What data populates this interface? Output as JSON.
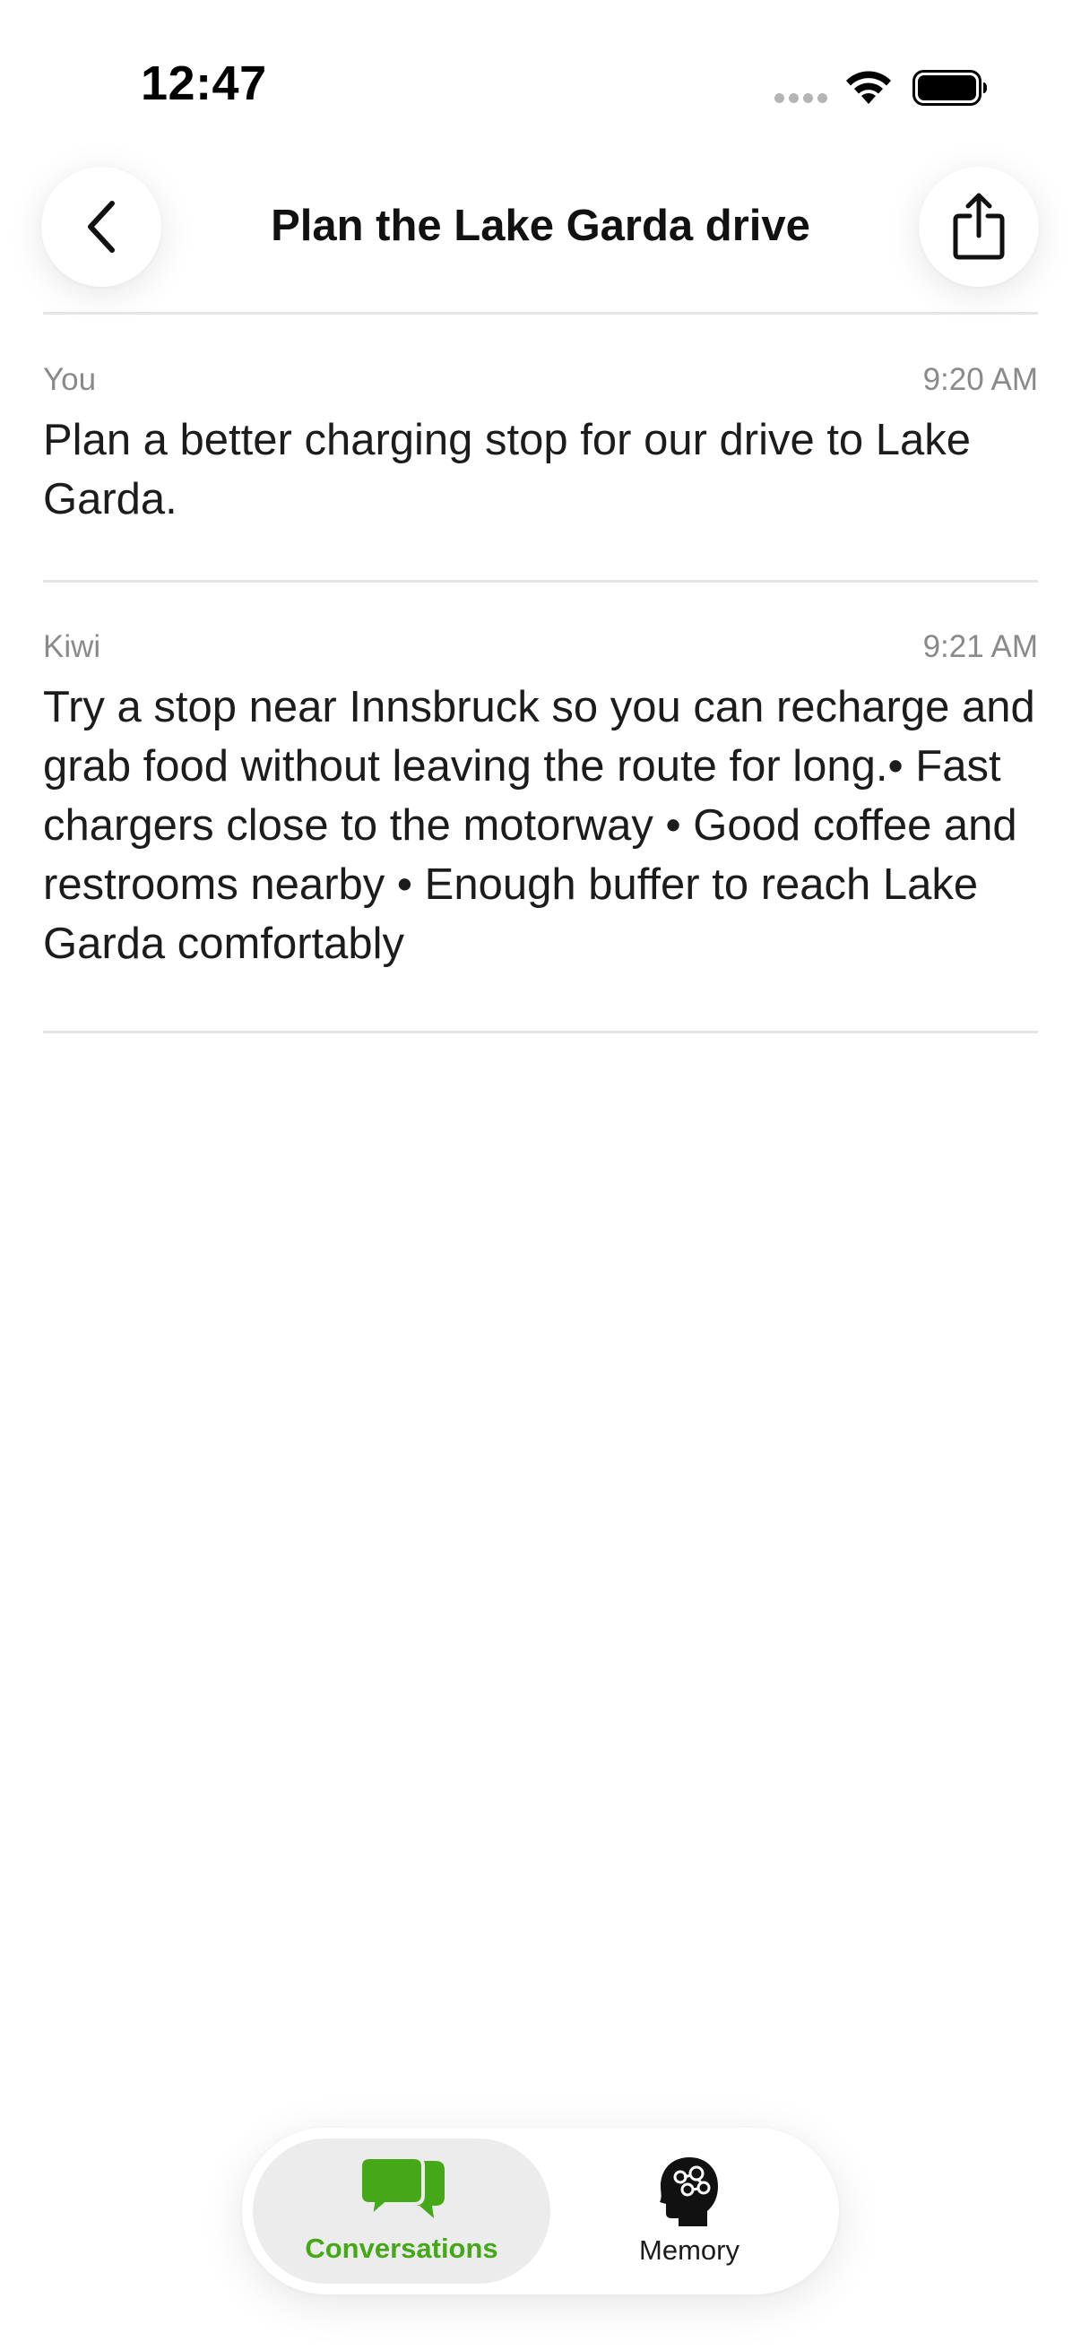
{
  "status_bar": {
    "time": "12:47"
  },
  "header": {
    "title": "Plan the Lake Garda drive"
  },
  "messages": [
    {
      "sender": "You",
      "time": "9:20 AM",
      "text": "Plan a better charging stop for our drive to Lake Garda."
    },
    {
      "sender": "Kiwi",
      "time": "9:21 AM",
      "text": "Try a stop near Innsbruck so you can recharge and grab food without leaving the route for long.• Fast chargers close to the motorway • Good coffee and restrooms nearby • Enough buffer to reach Lake Garda comfortably"
    }
  ],
  "tabbar": {
    "tabs": [
      {
        "label": "Conversations",
        "icon": "chat-bubbles-icon",
        "selected": true
      },
      {
        "label": "Memory",
        "icon": "brain-head-icon",
        "selected": false
      }
    ]
  },
  "colors": {
    "accent": "#45a818",
    "divider": "#e4e4e4",
    "muted_text": "#8a8a8a"
  }
}
